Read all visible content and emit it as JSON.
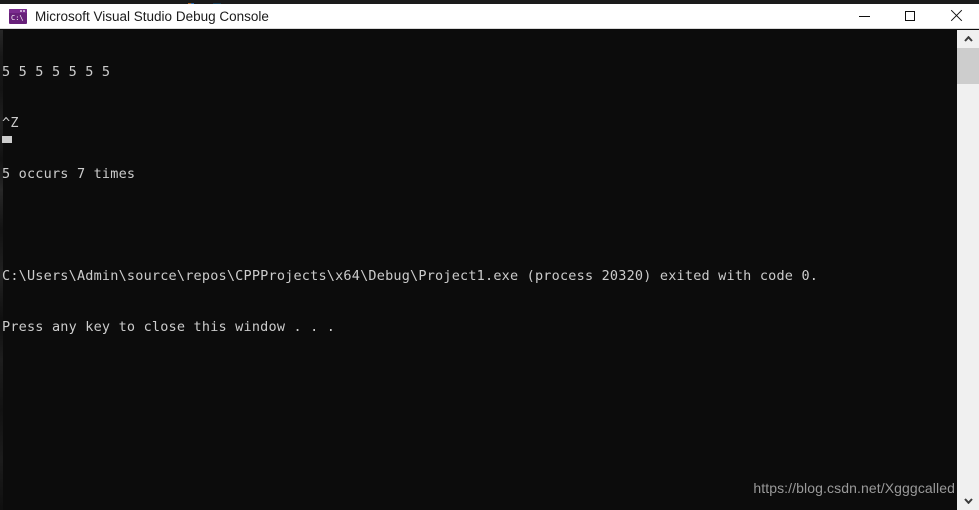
{
  "window": {
    "title": "Microsoft Visual Studio Debug Console",
    "icon": "console-app-icon",
    "icon_text": "C:\\",
    "colors": {
      "titlebar_bg": "#ffffff",
      "titlebar_text": "#1b1b1b",
      "console_bg": "#0c0c0c",
      "console_text": "#cccccc",
      "icon_purple": "#68217a",
      "scrollbar_track": "#f0f0f0",
      "scrollbar_thumb": "#cdcdcd",
      "watermark_text": "#9a9a9a"
    }
  },
  "titlebar_controls": {
    "minimize_label": "Minimize",
    "maximize_label": "Maximize",
    "close_label": "Close"
  },
  "console": {
    "lines": [
      "5 5 5 5 5 5 5",
      "^Z",
      "5 occurs 7 times",
      "",
      "C:\\Users\\Admin\\source\\repos\\CPPProjects\\x64\\Debug\\Project1.exe (process 20320) exited with code 0.",
      "Press any key to close this window . . ."
    ],
    "cursor": "block-cursor"
  },
  "watermark": {
    "text": "https://blog.csdn.net/Xgggcalled"
  },
  "scrollbar": {
    "up_arrow": "chevron-up-icon",
    "down_arrow": "chevron-down-icon"
  }
}
